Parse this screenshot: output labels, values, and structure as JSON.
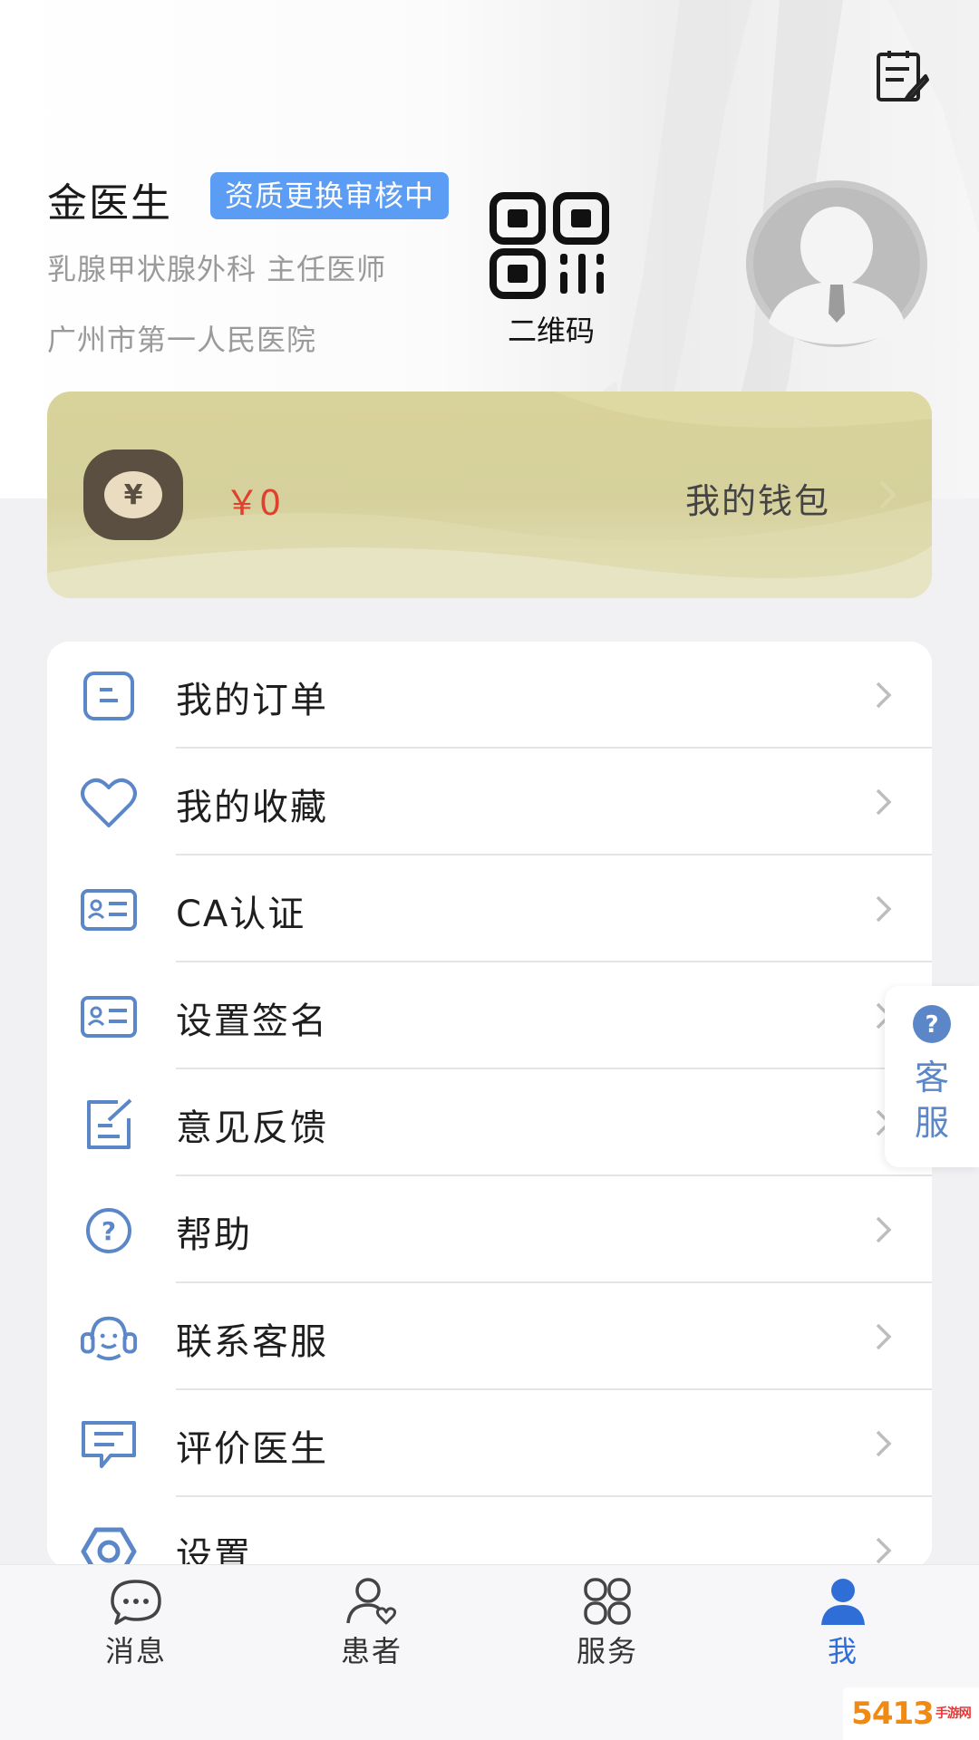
{
  "profile": {
    "name": "金医生",
    "status_badge": "资质更换审核中",
    "department_title": "乳腺甲状腺外科  主任医师",
    "hospital": "广州市第一人民医院",
    "qr_label": "二维码"
  },
  "wallet": {
    "amount": "￥0",
    "label": "我的钱包",
    "coin_symbol": "¥"
  },
  "menu": {
    "items": [
      {
        "label": "我的订单",
        "icon": "order-icon"
      },
      {
        "label": "我的收藏",
        "icon": "heart-icon"
      },
      {
        "label": "CA认证",
        "icon": "id-card-icon"
      },
      {
        "label": "设置签名",
        "icon": "id-card-icon"
      },
      {
        "label": "意见反馈",
        "icon": "feedback-icon"
      },
      {
        "label": "帮助",
        "icon": "help-icon"
      },
      {
        "label": "联系客服",
        "icon": "headset-icon"
      },
      {
        "label": "评价医生",
        "icon": "comment-icon"
      },
      {
        "label": "设置",
        "icon": "settings-icon"
      }
    ]
  },
  "float_service": {
    "line1": "客",
    "line2": "服"
  },
  "tabbar": {
    "tabs": [
      {
        "label": "消息",
        "icon": "chat-icon",
        "active": false
      },
      {
        "label": "患者",
        "icon": "patient-icon",
        "active": false
      },
      {
        "label": "服务",
        "icon": "grid-icon",
        "active": false
      },
      {
        "label": "我",
        "icon": "user-icon",
        "active": true
      }
    ]
  },
  "colors": {
    "accent": "#2f6ed6",
    "badge": "#5b9cf4",
    "icon_blue": "#5b87c9",
    "amount_red": "#e0402e",
    "wallet_bg": "#d8d39a"
  },
  "watermark": {
    "text": "5413",
    "sub": "手游网"
  }
}
